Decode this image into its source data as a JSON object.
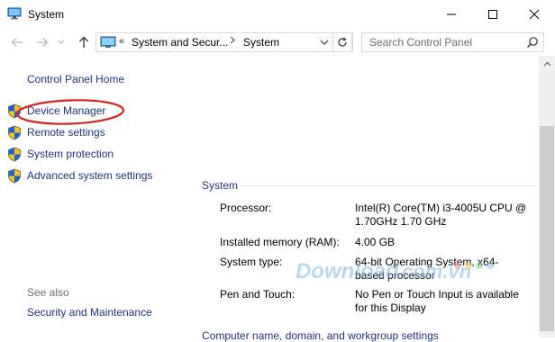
{
  "window": {
    "title": "System",
    "icon": "computer-icon",
    "controls": [
      "minimize-icon",
      "maximize-icon",
      "close-icon"
    ]
  },
  "navigation": {
    "breadcrumb_overflow": "«",
    "breadcrumbs": [
      "System and Secur...",
      "System"
    ],
    "search_placeholder": "Search Control Panel"
  },
  "sidebar": {
    "home_link": "Control Panel Home",
    "tasks": [
      {
        "label": "Device Manager",
        "icon": "shield-icon"
      },
      {
        "label": "Remote settings",
        "icon": "shield-icon"
      },
      {
        "label": "System protection",
        "icon": "shield-icon"
      },
      {
        "label": "Advanced system settings",
        "icon": "shield-icon"
      }
    ],
    "highlight_color": "#d9241b",
    "see_also_heading": "See also",
    "see_also_links": [
      "Security and Maintenance"
    ]
  },
  "system": {
    "section_title": "System",
    "rows": [
      {
        "label": "Processor:",
        "value": "Intel(R) Core(TM) i3-4005U CPU @ 1.70GHz   1.70 GHz"
      },
      {
        "label": "Installed memory (RAM):",
        "value": "4.00 GB"
      },
      {
        "label": "System type:",
        "value": "64-bit Operating System, x64-based processor"
      },
      {
        "label": "Pen and Touch:",
        "value": "No Pen or Touch Input is available for this Display"
      }
    ],
    "next_section_title": "Computer name, domain, and workgroup settings"
  },
  "watermark": {
    "text": "Download.com.vn"
  },
  "colors": {
    "link": "#1e3287",
    "muted": "#6d6d6d",
    "highlight": "#d9241b"
  }
}
